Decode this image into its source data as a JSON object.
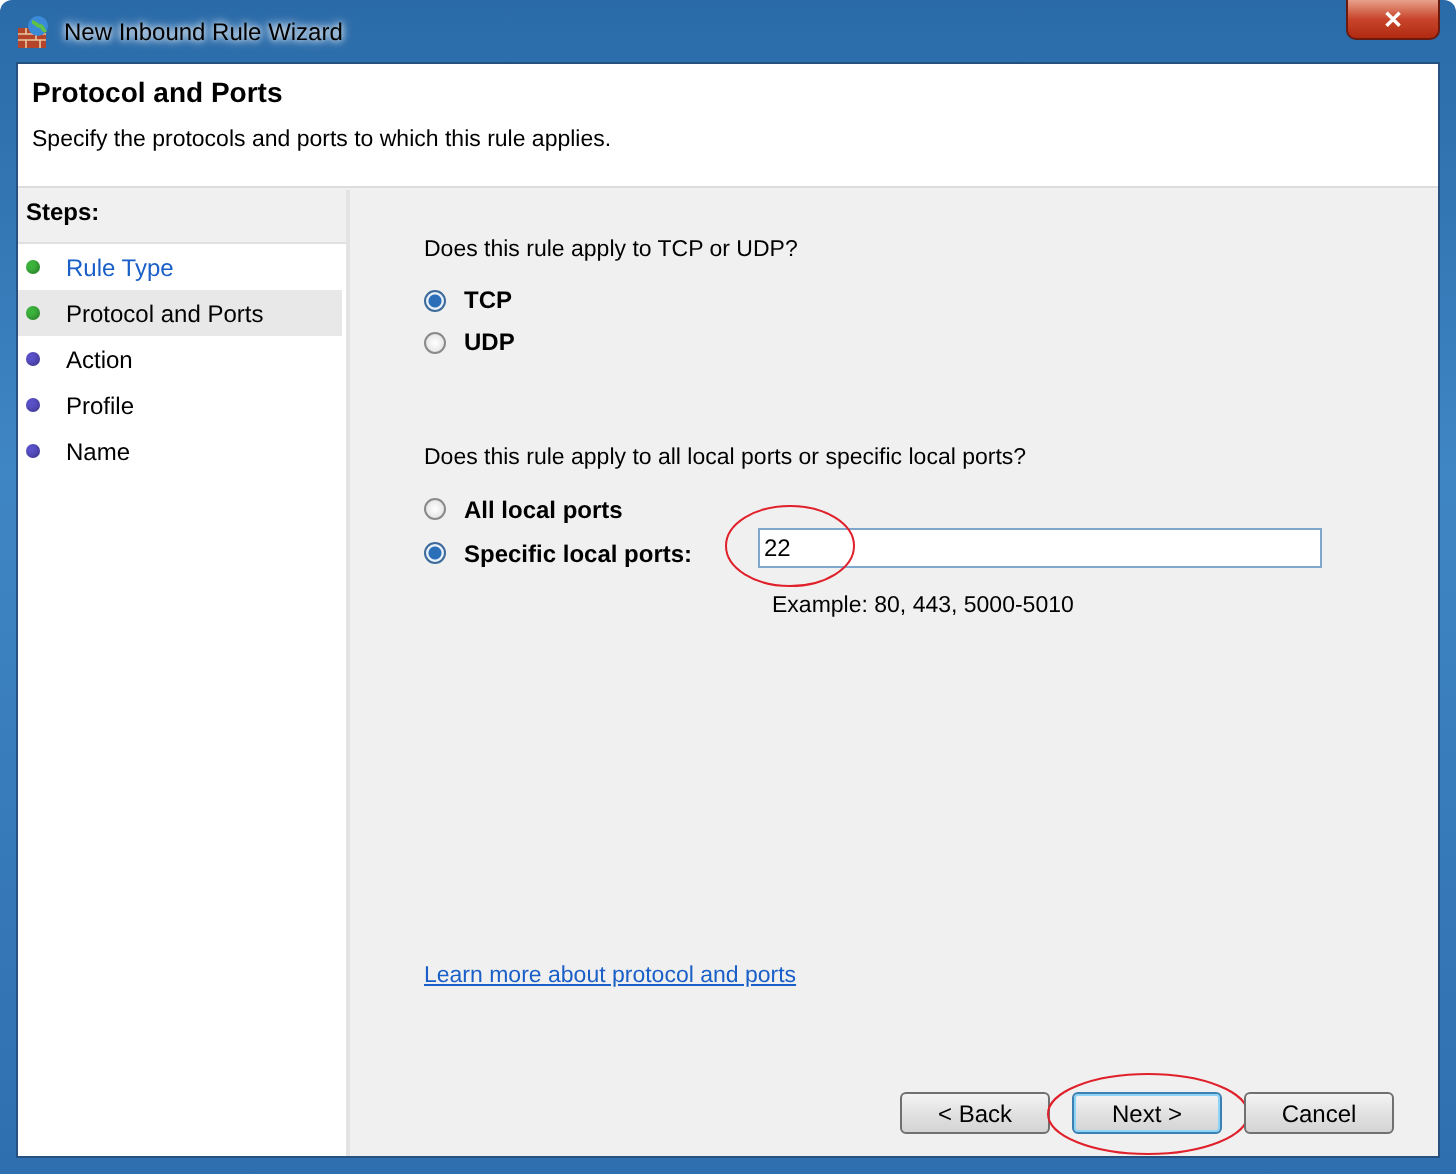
{
  "window": {
    "title": "New Inbound Rule Wizard",
    "close": "✕"
  },
  "header": {
    "title": "Protocol and Ports",
    "subtitle": "Specify the protocols and ports to which this rule applies."
  },
  "steps": {
    "heading": "Steps:",
    "items": [
      {
        "label": "Rule Type",
        "kind": "link",
        "selected": false,
        "color": "#3cb43c"
      },
      {
        "label": "Protocol and Ports",
        "kind": "text",
        "selected": true,
        "color": "#3cb43c"
      },
      {
        "label": "Action",
        "kind": "text",
        "selected": false,
        "color": "#5a50c8"
      },
      {
        "label": "Profile",
        "kind": "text",
        "selected": false,
        "color": "#5a50c8"
      },
      {
        "label": "Name",
        "kind": "text",
        "selected": false,
        "color": "#5a50c8"
      }
    ]
  },
  "protocol": {
    "question": "Does this rule apply to TCP or UDP?",
    "options": [
      {
        "label": "TCP",
        "selected": true
      },
      {
        "label": "UDP",
        "selected": false
      }
    ]
  },
  "ports": {
    "question": "Does this rule apply to all local ports or specific local ports?",
    "options": [
      {
        "label": "All local ports",
        "selected": false,
        "kind": "plain"
      },
      {
        "label": "Specific local ports:",
        "selected": true,
        "kind": "field"
      }
    ],
    "value": "22",
    "circled": true,
    "example": "Example: 80, 443, 5000-5010"
  },
  "learn_more": "Learn more about protocol and ports",
  "buttons": [
    {
      "label": "< Back",
      "default": false,
      "circled": false
    },
    {
      "label": "Next >",
      "default": true,
      "circled": true
    },
    {
      "label": "Cancel",
      "default": false,
      "circled": false
    }
  ]
}
